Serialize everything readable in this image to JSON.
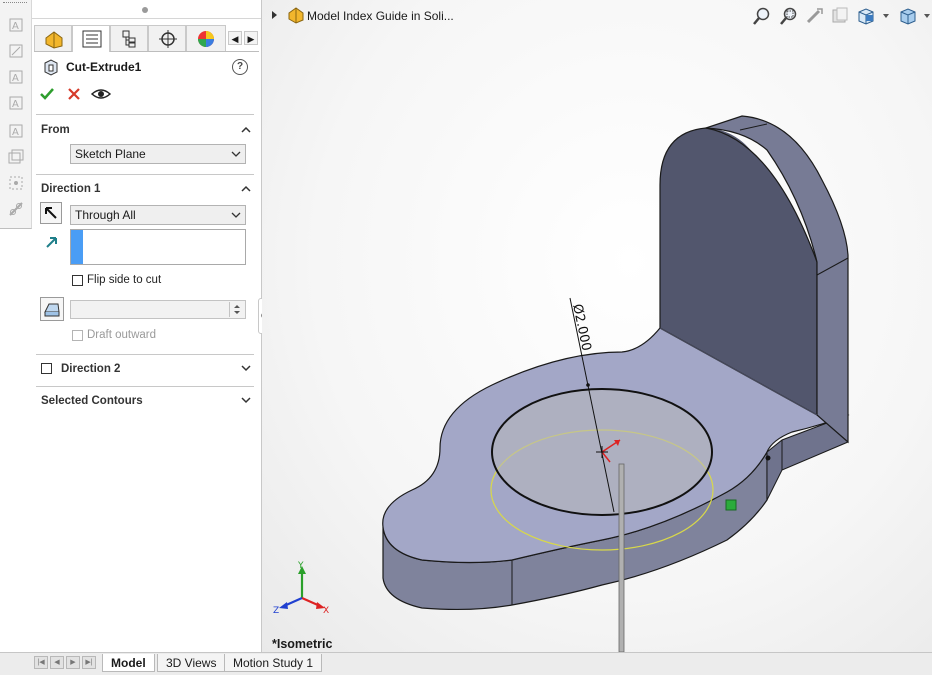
{
  "feature": {
    "title": "Cut-Extrude1",
    "help_label": "?"
  },
  "from": {
    "title": "From",
    "selected": "Sketch Plane"
  },
  "direction1": {
    "title": "Direction 1",
    "end_condition": "Through All",
    "flip_label": "Flip side to cut",
    "draft_label": "Draft outward"
  },
  "direction2": {
    "title": "Direction 2"
  },
  "selected_contours": {
    "title": "Selected Contours"
  },
  "tree": {
    "label": "Model Index Guide in Soli..."
  },
  "viewport": {
    "view_name": "*Isometric",
    "dimension": "Ø2.000",
    "triad": {
      "x": "X",
      "y": "Y",
      "z": "Z"
    }
  },
  "bottom_tabs": [
    "Model",
    "3D Views",
    "Motion Study 1"
  ],
  "colors": {
    "accept": "#2e9e2e",
    "cancel": "#d63a2a",
    "model_face": "#9fa3c4",
    "model_side": "#55596f"
  }
}
